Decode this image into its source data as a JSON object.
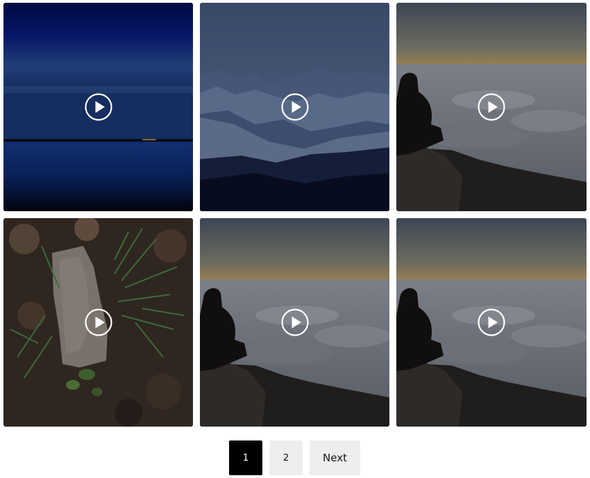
{
  "gallery": {
    "items": [
      {
        "scene": "blue-lake-dusk",
        "icon": "play-icon"
      },
      {
        "scene": "misty-mountains",
        "icon": "play-icon"
      },
      {
        "scene": "man-above-clouds",
        "icon": "play-icon"
      },
      {
        "scene": "stone-and-grass",
        "icon": "play-icon"
      },
      {
        "scene": "man-above-clouds",
        "icon": "play-icon"
      },
      {
        "scene": "man-above-clouds",
        "icon": "play-icon"
      }
    ]
  },
  "pagination": {
    "pages": [
      "1",
      "2"
    ],
    "active_page": "1",
    "next_label": "Next"
  },
  "colors": {
    "active_bg": "#000000",
    "inactive_bg": "#eeeeee"
  }
}
